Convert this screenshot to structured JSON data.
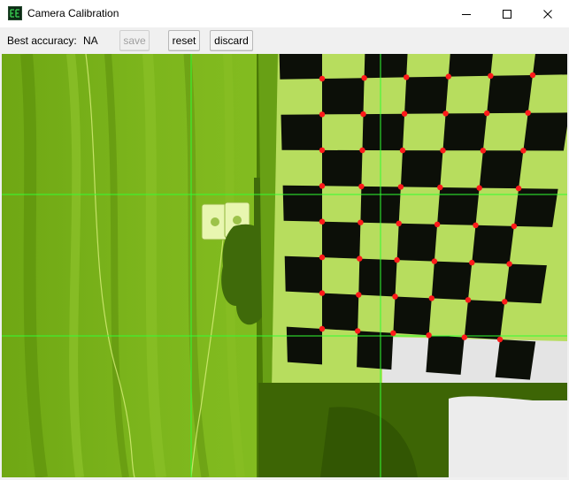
{
  "window": {
    "title": "Camera Calibration",
    "icon": "app-logo-icon",
    "controls": {
      "minimize": "minimize-icon",
      "maximize": "maximize-icon",
      "close": "close-icon"
    }
  },
  "toolbar": {
    "best_accuracy_label": "Best accuracy:",
    "best_accuracy_value": "NA",
    "save_label": "save",
    "save_enabled": false,
    "reset_label": "reset",
    "discard_label": "discard"
  },
  "camera_view": {
    "tint_color": "#6cae0a",
    "guide_line_color": "#32ff32",
    "corner_marker_color": "#ff1a1a",
    "board": {
      "detected_corner_rows": 8,
      "detected_corner_cols": 6
    }
  }
}
